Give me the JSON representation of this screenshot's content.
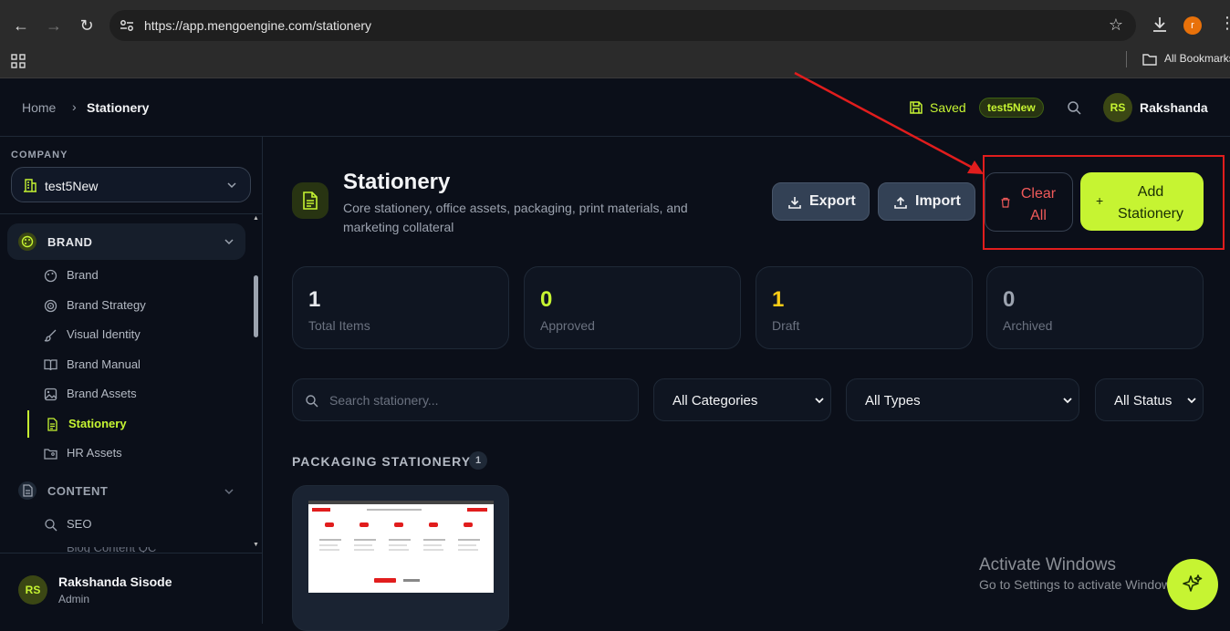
{
  "browser": {
    "url": "https://app.mengoengine.com/stationery",
    "profile_initial": "r",
    "bookmarks_label": "All Bookmarks"
  },
  "header": {
    "breadcrumb_home": "Home",
    "breadcrumb_current": "Stationery",
    "saved_label": "Saved",
    "workspace_badge": "test5New",
    "user_initials": "RS",
    "user_name": "Rakshanda"
  },
  "sidebar": {
    "company_label": "COMPANY",
    "company_name": "test5New",
    "brand_group": "BRAND",
    "items": [
      {
        "label": "Brand",
        "icon": "palette-icon"
      },
      {
        "label": "Brand Strategy",
        "icon": "target-icon"
      },
      {
        "label": "Visual Identity",
        "icon": "brush-icon"
      },
      {
        "label": "Brand Manual",
        "icon": "book-icon"
      },
      {
        "label": "Brand Assets",
        "icon": "image-icon"
      },
      {
        "label": "Stationery",
        "icon": "document-icon"
      },
      {
        "label": "HR Assets",
        "icon": "folder-user-icon"
      }
    ],
    "content_group": "CONTENT",
    "seo_label": "SEO",
    "blog_label": "Blog Content QC",
    "footer_initials": "RS",
    "footer_name": "Rakshanda Sisode",
    "footer_role": "Admin"
  },
  "page": {
    "title": "Stationery",
    "description": "Core stationery, office assets, packaging, print materials, and marketing collateral",
    "export_label": "Export",
    "import_label": "Import",
    "clear_label_1": "Clear",
    "clear_label_2": "All",
    "add_label_1": "Add",
    "add_label_2": "Stationery"
  },
  "stats": [
    {
      "value": "1",
      "label": "Total Items",
      "color": "#e5e7eb"
    },
    {
      "value": "0",
      "label": "Approved",
      "color": "#c6f432"
    },
    {
      "value": "1",
      "label": "Draft",
      "color": "#facc15"
    },
    {
      "value": "0",
      "label": "Archived",
      "color": "#9ca3af"
    }
  ],
  "filters": {
    "search_placeholder": "Search stationery...",
    "category": "All Categories",
    "type": "All Types",
    "status": "All Status"
  },
  "section": {
    "title": "PACKAGING STATIONERY",
    "count": "1"
  },
  "watermark": {
    "line1": "Activate Windows",
    "line2": "Go to Settings to activate Windows."
  },
  "colors": {
    "accent": "#c6f432",
    "danger": "#f15a5a",
    "background": "#0b0f19"
  }
}
